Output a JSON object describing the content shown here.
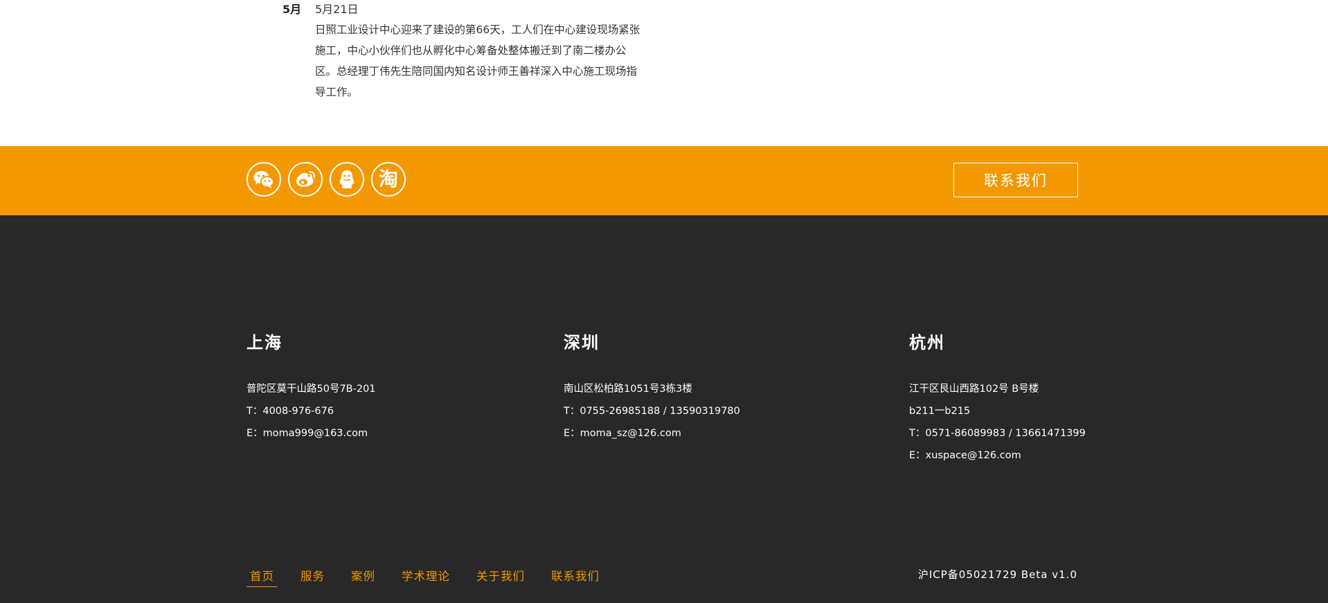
{
  "news": {
    "month": "5月",
    "date": "5月21日",
    "body": "日照工业设计中心迎来了建设的第66天，工人们在中心建设现场紧张施工，中心小伙伴们也从孵化中心筹备处整体搬迁到了南二楼办公区。总经理丁伟先生陪同国内知名设计师王善祥深入中心施工现场指导工作。"
  },
  "social": {
    "icons": [
      "wechat-icon",
      "weibo-icon",
      "qq-icon",
      "taobao-icon"
    ],
    "taobao_glyph": "淘",
    "contact_label": "联系我们"
  },
  "offices": [
    {
      "city": "上海",
      "lines": [
        "普陀区莫干山路50号7B-201",
        "T：4008-976-676",
        "E：moma999@163.com"
      ]
    },
    {
      "city": "深圳",
      "lines": [
        "南山区松柏路1051号3栋3楼",
        "T：0755-26985188 / 13590319780",
        "E：moma_sz@126.com"
      ]
    },
    {
      "city": "杭州",
      "lines": [
        "江干区艮山西路102号 B号楼",
        "b211一b215",
        "T：0571-86089983 / 13661471399",
        "E：xuspace@126.com"
      ]
    }
  ],
  "footer_nav": {
    "items": [
      "首页",
      "服务",
      "案例",
      "学术理论",
      "关于我们",
      "联系我们"
    ],
    "active_index": 0
  },
  "icp": "沪ICP备05021729 Beta v1.0",
  "colors": {
    "accent": "#f39800",
    "footer_bg": "#282828",
    "text_dark": "#333333"
  }
}
